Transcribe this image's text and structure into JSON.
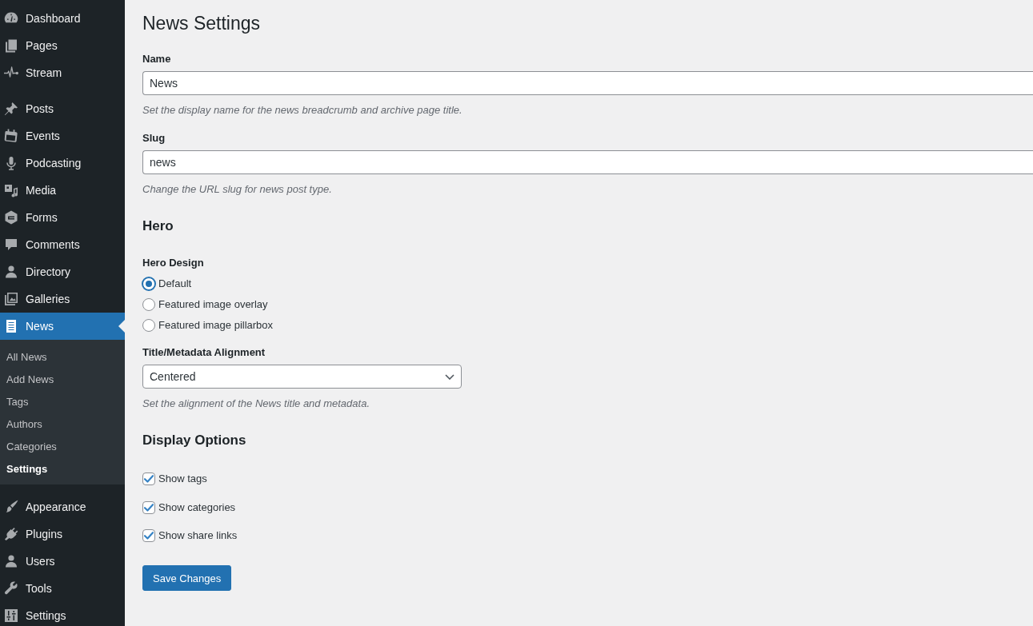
{
  "sidebar": {
    "groups": [
      {
        "items": [
          {
            "label": "Dashboard",
            "selected": false
          },
          {
            "label": "Pages",
            "selected": false
          },
          {
            "label": "Stream",
            "selected": false
          }
        ]
      },
      {
        "items": [
          {
            "label": "Posts",
            "selected": false
          },
          {
            "label": "Events",
            "selected": false
          },
          {
            "label": "Podcasting",
            "selected": false
          },
          {
            "label": "Media",
            "selected": false
          },
          {
            "label": "Forms",
            "selected": false
          },
          {
            "label": "Comments",
            "selected": false
          },
          {
            "label": "Directory",
            "selected": false
          },
          {
            "label": "Galleries",
            "selected": false
          },
          {
            "label": "News",
            "selected": true,
            "children": [
              {
                "label": "All News",
                "selected": false
              },
              {
                "label": "Add News",
                "selected": false
              },
              {
                "label": "Tags",
                "selected": false
              },
              {
                "label": "Authors",
                "selected": false
              },
              {
                "label": "Categories",
                "selected": false
              },
              {
                "label": "Settings",
                "selected": true
              }
            ]
          }
        ]
      },
      {
        "items": [
          {
            "label": "Appearance",
            "selected": false
          },
          {
            "label": "Plugins",
            "selected": false
          },
          {
            "label": "Users",
            "selected": false
          },
          {
            "label": "Tools",
            "selected": false
          },
          {
            "label": "Settings",
            "selected": false
          }
        ]
      }
    ]
  },
  "title": "News Settings",
  "fields": [
    {
      "label": "Name",
      "value": "News",
      "description": "Set the display name for the news breadcrumb and archive page title."
    },
    {
      "label": "Slug",
      "value": "news",
      "description": "Change the URL slug for news post type."
    }
  ],
  "hero": {
    "heading": "Hero",
    "design": {
      "label": "Hero Design",
      "options": [
        {
          "label": "Default",
          "selected": true
        },
        {
          "label": "Featured image overlay",
          "selected": false
        },
        {
          "label": "Featured image pillarbox",
          "selected": false
        }
      ]
    },
    "alignment": {
      "label": "Title/Metadata Alignment",
      "value": "Centered",
      "description": "Set the alignment of the News title and metadata."
    }
  },
  "display_options": {
    "heading": "Display Options",
    "options": [
      {
        "label": "Show tags",
        "checked": true
      },
      {
        "label": "Show categories",
        "checked": true
      },
      {
        "label": "Show share links",
        "checked": true
      }
    ]
  },
  "save_button": "Save Changes"
}
